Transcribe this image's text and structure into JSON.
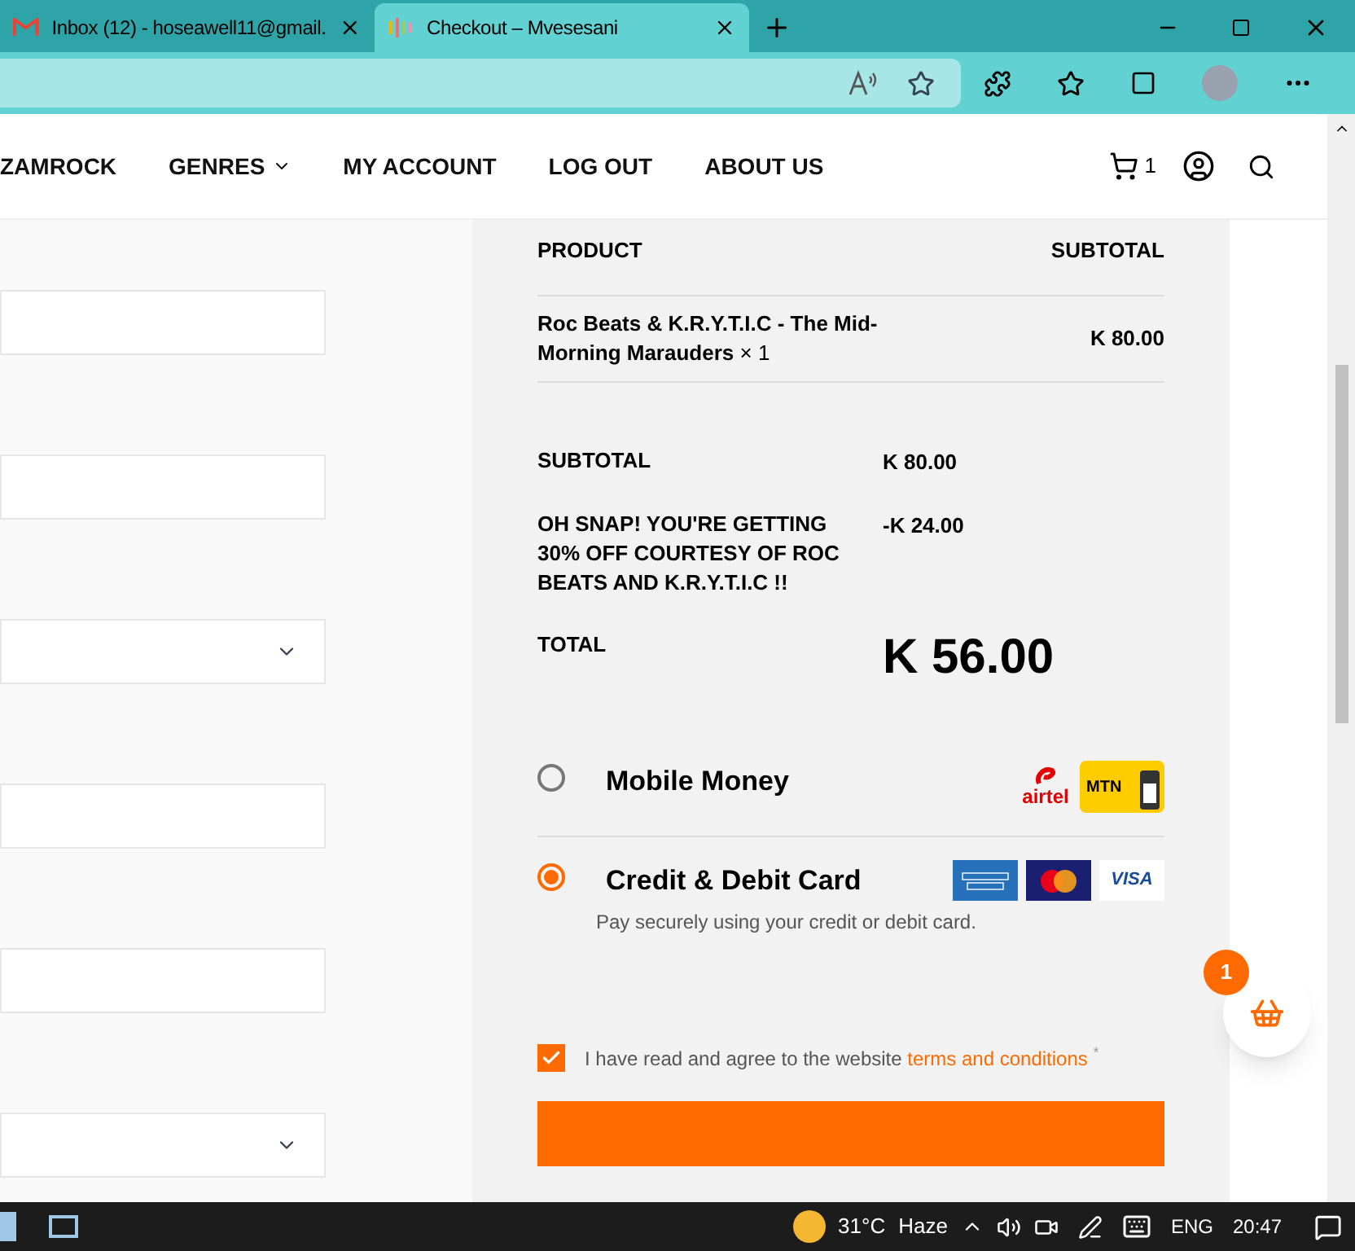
{
  "browser": {
    "tabs": [
      {
        "title": "Inbox (12) - hoseawell11@gmail.",
        "selected": false
      },
      {
        "title": "Checkout – Mvesesani",
        "selected": true
      }
    ]
  },
  "nav": {
    "items": [
      {
        "label": "ZAMROCK",
        "kind": "link"
      },
      {
        "label": "GENRES",
        "kind": "dropdown"
      },
      {
        "label": "MY ACCOUNT",
        "kind": "link"
      },
      {
        "label": "LOG OUT",
        "kind": "link"
      },
      {
        "label": "ABOUT US",
        "kind": "link"
      }
    ],
    "cart_count": "1"
  },
  "form": {
    "fields": [
      {
        "kind": "text"
      },
      {
        "kind": "text"
      },
      {
        "kind": "select"
      },
      {
        "kind": "text"
      },
      {
        "kind": "text"
      },
      {
        "kind": "select"
      }
    ]
  },
  "order": {
    "columns": [
      "PRODUCT",
      "SUBTOTAL"
    ],
    "items": [
      {
        "name": "Roc Beats & K.R.Y.T.I.C - The Mid-Morning Marauders",
        "quantity": "× 1",
        "subtotal": "K 80.00"
      }
    ],
    "totals": [
      {
        "label": "SUBTOTAL",
        "value": "K 80.00",
        "kind": "normal"
      },
      {
        "label": "OH SNAP! YOU'RE GETTING 30% OFF COURTESY OF ROC BEATS AND K.R.Y.T.I.C !!",
        "value": "-K 24.00",
        "kind": "normal"
      },
      {
        "label": "TOTAL",
        "value": "K 56.00",
        "kind": "grand"
      }
    ],
    "payment_methods": [
      {
        "label": "Mobile Money",
        "selected": false,
        "logos": [
          {
            "kind": "airtel",
            "text": "airtel"
          },
          {
            "kind": "mtn",
            "text": "MTN"
          }
        ]
      },
      {
        "label": "Credit & Debit Card",
        "selected": true,
        "description": "Pay securely using your credit or debit card.",
        "logos": [
          {
            "kind": "amex"
          },
          {
            "kind": "mastercard"
          },
          {
            "kind": "visa",
            "text": "VISA"
          }
        ]
      }
    ],
    "terms": {
      "text": "I have read and agree to the website",
      "link": "terms and conditions",
      "required_mark": "*",
      "checked": true
    }
  },
  "floating_cart": {
    "count": "1"
  },
  "taskbar": {
    "temperature": "31°C",
    "weather": "Haze",
    "language": "ENG",
    "time": "20:47"
  }
}
